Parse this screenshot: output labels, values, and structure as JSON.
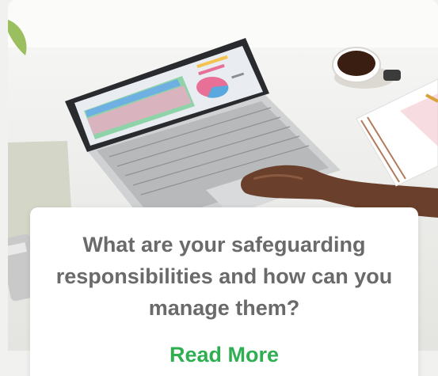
{
  "article": {
    "title": "What are your safeguarding responsibilities and how can you manage them?",
    "cta_label": "Read More"
  },
  "colors": {
    "title_text": "#6a6a6a",
    "cta_text": "#2fae52",
    "caption_bg": "#ffffff"
  },
  "icons": {
    "photo": "laptop-desk-photo"
  }
}
